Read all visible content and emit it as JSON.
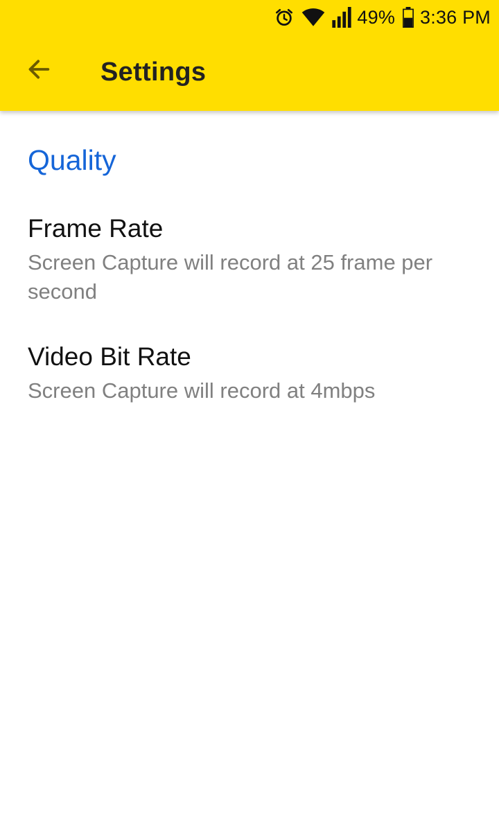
{
  "status_bar": {
    "icons": [
      "alarm-icon",
      "wifi-icon",
      "signal-icon",
      "battery-icon"
    ],
    "battery_percent": "49%",
    "time": "3:36 PM"
  },
  "toolbar": {
    "back_icon": "arrow-back-icon",
    "title": "Settings",
    "background_color": "#FFDE00"
  },
  "category": {
    "title": "Quality",
    "color": "#1565D8"
  },
  "preferences": [
    {
      "title": "Frame Rate",
      "summary": "Screen Capture will record at 25 frame per second"
    },
    {
      "title": "Video Bit Rate",
      "summary": "Screen Capture will record at 4mbps"
    }
  ]
}
